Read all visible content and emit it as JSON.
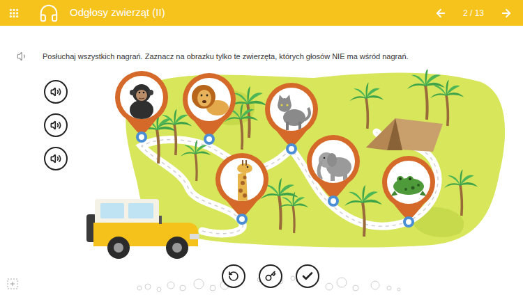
{
  "header": {
    "title": "Odgłosy zwierząt (II)",
    "page": "2 / 13"
  },
  "instruction": "Posłuchaj wszystkich nagrań. Zaznacz na obrazku tylko te zwierzęta, których głosów NIE ma wśród nagrań.",
  "recordings": [
    {
      "kind": "sound"
    },
    {
      "kind": "sound"
    },
    {
      "kind": "sound"
    }
  ],
  "animals": [
    {
      "kind": "chimpanzee",
      "selected": false
    },
    {
      "kind": "lion",
      "selected": false
    },
    {
      "kind": "cat",
      "selected": false
    },
    {
      "kind": "giraffe",
      "selected": false
    },
    {
      "kind": "elephant",
      "selected": false
    },
    {
      "kind": "frog",
      "selected": false
    }
  ],
  "toolbar": [
    {
      "kind": "undo"
    },
    {
      "kind": "key"
    },
    {
      "kind": "check"
    }
  ]
}
